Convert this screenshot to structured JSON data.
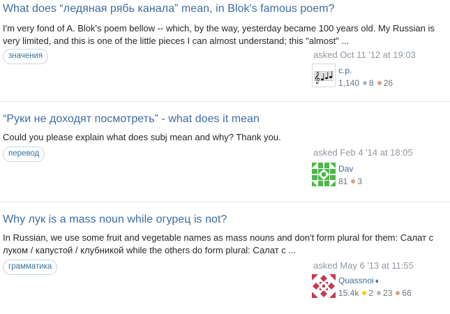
{
  "colors": {
    "link": "#3f6ba4",
    "tag_text": "#39739d",
    "tag_border": "#c6d6e4",
    "meta": "#9199a1",
    "gold": "#ffcc01",
    "silver": "#b4b8bc",
    "bronze": "#d1a684"
  },
  "questions": [
    {
      "title": "What does “ледяная рябь канала” mean, in Blok's famous poem?",
      "excerpt": "I'm very fond of A. Blok's poem bellow -- which, by the way, yesterday became 100 years old. My Russian is very limited, and this is one of the little pieces I can almost understand; this \"almost\" ...",
      "tag": "значения",
      "asked": "asked Oct 11 '12 at 19:03",
      "user": {
        "name": "c.p.",
        "reputation": "1,140",
        "silver": "8",
        "bronze": "26",
        "avatar_icon": "music-notes-avatar-icon"
      }
    },
    {
      "title": "“Руки не доходят посмотреть” - what does it mean",
      "excerpt": "Could you please explain what does subj mean and why? Thank you.",
      "tag": "перевод",
      "asked": "asked Feb 4 '14 at 18:05",
      "user": {
        "name": "Dav",
        "reputation": "81",
        "bronze": "3",
        "avatar_icon": "green-identicon-avatar"
      }
    },
    {
      "title": "Why лук is a mass noun while огурец is not?",
      "excerpt": "In Russian, we use some fruit and vegetable names as mass nouns and don't form plural for them: Салат с луком / капустой / клубникой while the others do form plural: Салат с ...",
      "tag": "грамматика",
      "asked": "asked May 6 '13 at 11:55",
      "user": {
        "name": "Quassnoi",
        "moderator_mark": "♦",
        "reputation": "15.4k",
        "gold": "2",
        "silver": "23",
        "bronze": "66",
        "avatar_icon": "red-identicon-avatar"
      }
    }
  ]
}
